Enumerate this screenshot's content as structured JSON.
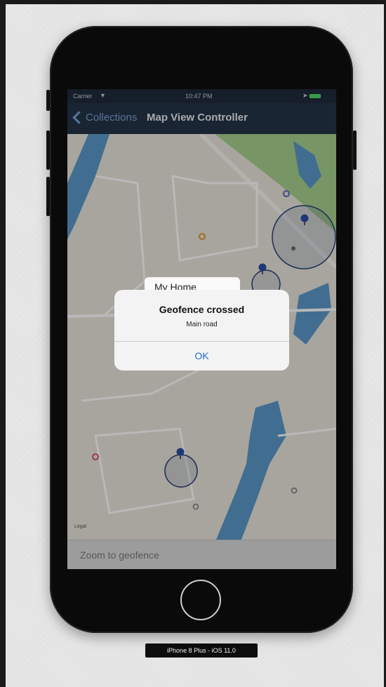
{
  "device": {
    "label": "iPhone 8 Plus - iOS 11.0"
  },
  "status_bar": {
    "carrier": "Carrier",
    "time": "10:47 PM"
  },
  "nav_bar": {
    "back_label": "Collections",
    "title": "Map View Controller"
  },
  "map": {
    "annotation_title": "My Home",
    "legal_label": "Legal"
  },
  "toolbar": {
    "zoom_label": "Zoom to geofence"
  },
  "alert": {
    "title": "Geofence crossed",
    "message": "Main road",
    "ok_label": "OK"
  },
  "colors": {
    "nav_background": "#243447",
    "tint": "#1d6cd6",
    "water": "#5b98c9",
    "park": "#a6cf8c",
    "geofence_pin": "#2c4ea3"
  }
}
